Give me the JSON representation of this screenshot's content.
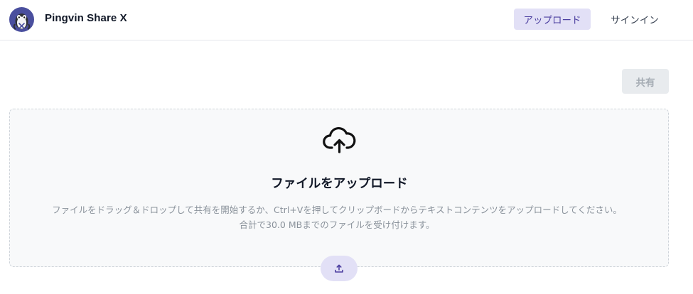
{
  "header": {
    "app_name": "Pingvin Share X",
    "nav": {
      "upload_label": "アップロード",
      "signin_label": "サインイン"
    }
  },
  "toolbar": {
    "share_label": "共有"
  },
  "dropzone": {
    "icon": "cloud-upload-icon",
    "title": "ファイルをアップロード",
    "description_line1": "ファイルをドラッグ＆ドロップして共有を開始するか、Ctrl+Vを押してクリップボードからテキストコンテンツをアップロードしてください。",
    "description_line2": "合計で30.0 MBまでのファイルを受け付けます。",
    "upload_button_icon": "upload-icon"
  },
  "colors": {
    "accent": "#4c3fa0",
    "accent_light": "#e2e0f6",
    "logo_bg": "#4a4f9e"
  }
}
